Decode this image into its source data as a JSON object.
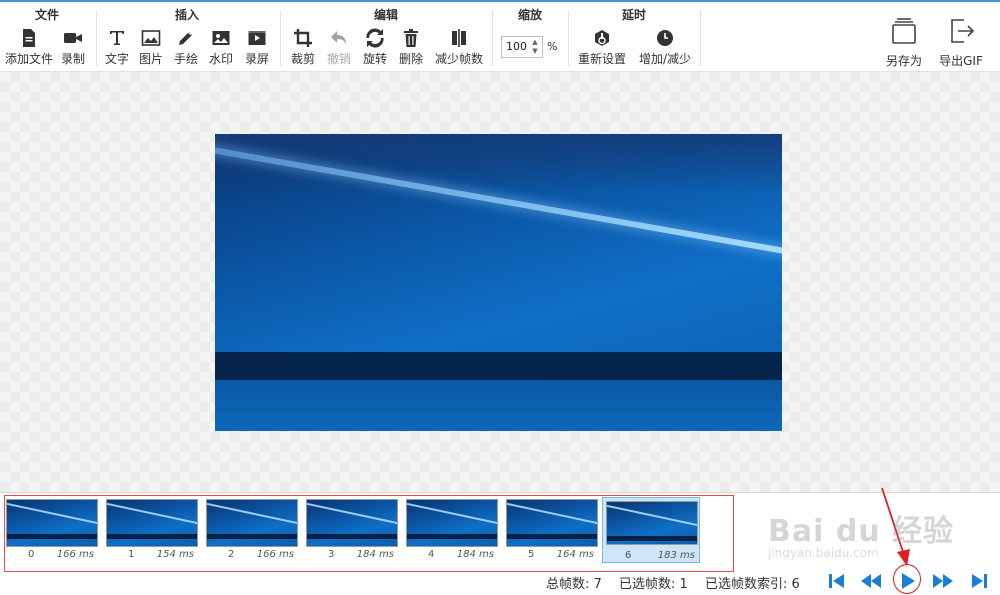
{
  "toolbar": {
    "groups": {
      "file": "文件",
      "insert": "插入",
      "edit": "编辑",
      "zoom": "缩放",
      "delay": "延时"
    },
    "file": {
      "add_file": "添加文件",
      "record": "录制"
    },
    "insert": {
      "text": "文字",
      "image": "图片",
      "draw": "手绘",
      "watermark": "水印",
      "screen_record": "录屏"
    },
    "edit": {
      "crop": "裁剪",
      "undo": "撤销",
      "rotate": "旋转",
      "delete": "删除",
      "reduce_frames": "减少帧数"
    },
    "zoom": {
      "value": "100",
      "unit": "%"
    },
    "delay": {
      "reset": "重新设置",
      "increase_decrease": "增加/减少"
    },
    "save_as": "另存为",
    "export_gif": "导出GIF"
  },
  "frames": [
    {
      "index": "0",
      "duration": "166 ms",
      "selected": false
    },
    {
      "index": "1",
      "duration": "154 ms",
      "selected": false
    },
    {
      "index": "2",
      "duration": "166 ms",
      "selected": false
    },
    {
      "index": "3",
      "duration": "184 ms",
      "selected": false
    },
    {
      "index": "4",
      "duration": "184 ms",
      "selected": false
    },
    {
      "index": "5",
      "duration": "164 ms",
      "selected": false
    },
    {
      "index": "6",
      "duration": "183 ms",
      "selected": true
    }
  ],
  "status": {
    "total_frames": "总帧数: 7",
    "selected_frames": "已选帧数: 1",
    "selected_index": "已选帧数索引: 6"
  },
  "watermark": {
    "text": "Bai du 经验",
    "sub": "jingyan.baidu.com"
  },
  "colors": {
    "accent": "#1a7fd4",
    "highlight": "#e02020",
    "selection": "#cde6f7"
  }
}
